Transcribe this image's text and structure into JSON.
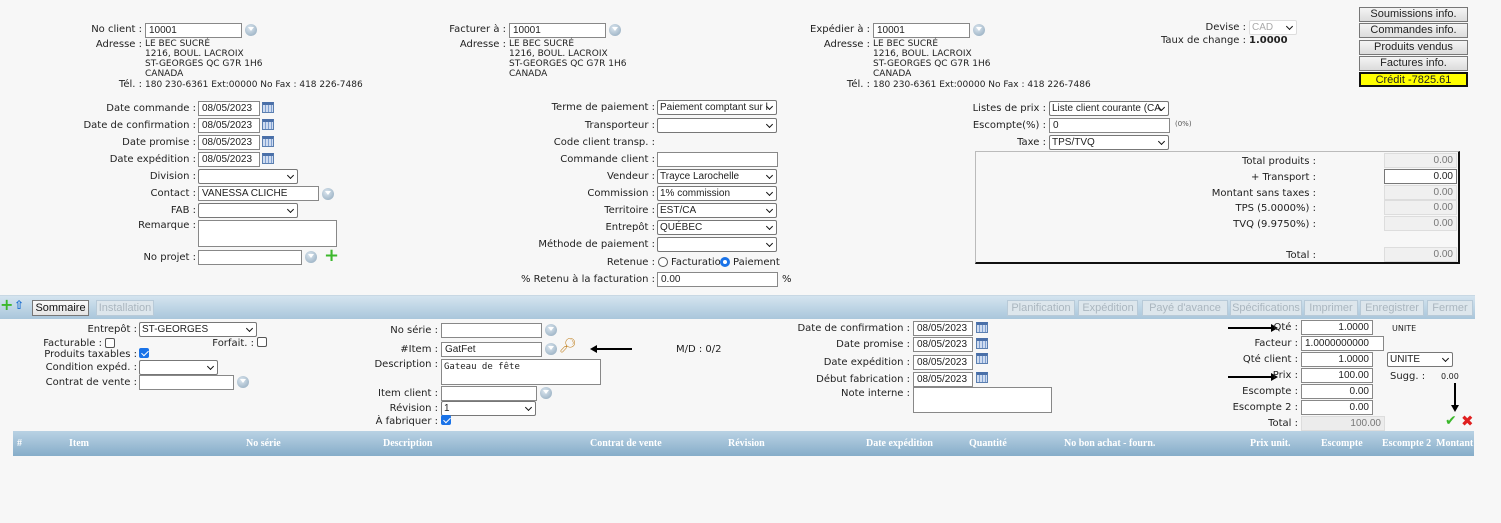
{
  "client": {
    "no_client_label": "No client :",
    "no_client": "10001",
    "adresse_label": "Adresse :",
    "address": [
      "LE BEC SUCRÉ",
      "1216, BOUL. LACROIX",
      "ST-GEORGES QC G7R 1H6",
      "CANADA"
    ],
    "tel_label": "Tél. :",
    "tel": "180 230-6361 Ext:00000 No Fax : 418 226-7486"
  },
  "billing": {
    "label": "Facturer à :",
    "value": "10001",
    "adresse_label": "Adresse :",
    "address": [
      "LE BEC SUCRÉ",
      "1216, BOUL. LACROIX",
      "ST-GEORGES QC G7R 1H6",
      "CANADA"
    ]
  },
  "shipping": {
    "label": "Expédier à :",
    "value": "10001",
    "adresse_label": "Adresse :",
    "address": [
      "LE BEC SUCRÉ",
      "1216, BOUL. LACROIX",
      "ST-GEORGES QC G7R 1H6",
      "CANADA"
    ],
    "tel_label": "Tél. :",
    "tel": "180 230-6361 Ext:00000 No Fax : 418 226-7486"
  },
  "currency": {
    "devise_label": "Devise :",
    "devise": "CAD",
    "taux_label": "Taux de change :",
    "taux": "1.0000"
  },
  "side_buttons": [
    "Soumissions info.",
    "Commandes info.",
    "Produits vendus",
    "Factures info.",
    "Crédit -7825.61"
  ],
  "credit_color": "#ffff00",
  "left_form": {
    "date_commande_label": "Date commande :",
    "date_commande": "08/05/2023",
    "date_confirmation_label": "Date de confirmation :",
    "date_confirmation": "08/05/2023",
    "date_promise_label": "Date promise :",
    "date_promise": "08/05/2023",
    "date_expedition_label": "Date expédition :",
    "date_expedition": "08/05/2023",
    "division_label": "Division :",
    "division": "",
    "contact_label": "Contact :",
    "contact": "VANESSA CLICHE",
    "fab_label": "FAB :",
    "fab": "",
    "remarque_label": "Remarque :",
    "remarque": "",
    "no_projet_label": "No projet :",
    "no_projet": ""
  },
  "mid_form": {
    "terme_label": "Terme de paiement :",
    "terme": "Paiement comptant sur l",
    "transporteur_label": "Transporteur :",
    "transporteur": "",
    "code_client_label": "Code client transp. :",
    "commande_client_label": "Commande client :",
    "commande_client": "",
    "vendeur_label": "Vendeur :",
    "vendeur": "Trayce Larochelle",
    "commission_label": "Commission :",
    "commission": "1% commission",
    "territoire_label": "Territoire :",
    "territoire": "EST/CA",
    "entrepot_label": "Entrepôt :",
    "entrepot": "QUÉBEC",
    "methode_label": "Méthode de paiement :",
    "methode": "",
    "retenue_label": "Retenue :",
    "retenue_options": [
      "Facturation",
      "Paiement"
    ],
    "retenue_selected": "Paiement",
    "pct_retenu_label": "% Retenu à la facturation :",
    "pct_retenu": "0.00",
    "pct_sign": "%"
  },
  "right_form": {
    "listes_label": "Listes de prix :",
    "listes": "Liste client courante (CA",
    "escompte_label": "Escompte(%) :",
    "escompte": "0",
    "escompte_hint": "(0%)",
    "taxe_label": "Taxe :",
    "taxe": "TPS/TVQ"
  },
  "totals": [
    {
      "label": "Total produits :",
      "value": "0.00"
    },
    {
      "label": "+ Transport :",
      "value": "0.00"
    },
    {
      "label": "Montant sans taxes :",
      "value": "0.00"
    },
    {
      "label": "TPS (5.0000%) :",
      "value": "0.00"
    },
    {
      "label": "TVQ (9.9750%) :",
      "value": "0.00"
    },
    {
      "label": "Total :",
      "value": "0.00"
    }
  ],
  "toolbar": {
    "tabs": [
      "Sommaire",
      "Installation"
    ],
    "actions": [
      "Planification",
      "Expédition",
      "Payé d'avance",
      "Spécifications",
      "Imprimer",
      "Enregistrer",
      "Fermer"
    ]
  },
  "line": {
    "entrepot_label": "Entrepôt :",
    "entrepot": "ST-GEORGES",
    "facturable_label": "Facturable :",
    "forfait_label": "Forfait. :",
    "taxables_label": "Produits taxables :",
    "condition_label": "Condition expéd. :",
    "condition": "",
    "contrat_label": "Contrat de vente :",
    "contrat": "",
    "no_serie_label": "No série :",
    "no_serie": "",
    "item_label": "#Item :",
    "item": "GatFet",
    "md": "M/D : 0/2",
    "description_label": "Description :",
    "description": "Gateau de fête",
    "item_client_label": "Item client :",
    "item_client": "",
    "revision_label": "Révision :",
    "revision": "1",
    "fabriquer_label": "À fabriquer :",
    "date_confirmation_label": "Date de confirmation :",
    "date_confirmation": "08/05/2023",
    "date_promise_label": "Date promise :",
    "date_promise": "08/05/2023",
    "date_expedition_label": "Date expédition :",
    "date_expedition": "08/05/2023",
    "debut_label": "Début fabrication :",
    "debut": "08/05/2023",
    "note_label": "Note interne :",
    "note": "",
    "qte_label": "Qté :",
    "qte": "1.0000",
    "unite": "UNITE",
    "facteur_label": "Facteur :",
    "facteur": "1.0000000000",
    "qte_client_label": "Qté client :",
    "qte_client": "1.0000",
    "unite_select": "UNITE",
    "prix_label": "Prix :",
    "prix": "100.00",
    "sugg_label": "Sugg. :",
    "sugg": "0.00",
    "escompte_label": "Escompte :",
    "escompte": "0.00",
    "escompte2_label": "Escompte 2 :",
    "escompte2": "0.00",
    "total_label": "Total :",
    "total": "100.00"
  },
  "table_headers": [
    "#",
    "Item",
    "No série",
    "Description",
    "Contrat de vente",
    "Révision",
    "Date expédition",
    "Quantité",
    "No bon achat - fourn.",
    "Prix unit.",
    "Escompte",
    "Escompte 2",
    "Montant"
  ]
}
